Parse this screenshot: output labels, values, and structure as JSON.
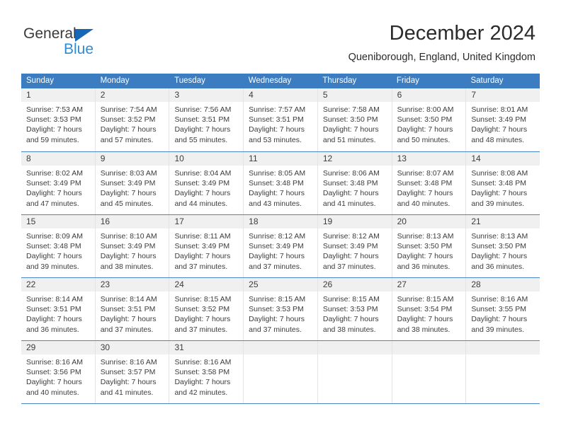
{
  "brand": {
    "name_dark": "General",
    "name_blue": "Blue",
    "color_dark": "#3a3a3a",
    "color_blue": "#2e8bd4",
    "triangle_color": "#1667b4"
  },
  "header": {
    "title": "December 2024",
    "subtitle": "Queniborough, England, United Kingdom"
  },
  "theme": {
    "header_row_bg": "#3b7dc0",
    "header_row_text": "#ffffff",
    "day_number_band_bg": "#f0f0f0",
    "week_divider": "#4a86c5",
    "column_divider": "#e4e4e4",
    "body_text": "#3c3c3c"
  },
  "calendar": {
    "day_names": [
      "Sunday",
      "Monday",
      "Tuesday",
      "Wednesday",
      "Thursday",
      "Friday",
      "Saturday"
    ],
    "weeks": [
      [
        {
          "day": "1",
          "sunrise": "Sunrise: 7:53 AM",
          "sunset": "Sunset: 3:53 PM",
          "daylight_line1": "Daylight: 7 hours",
          "daylight_line2": "and 59 minutes."
        },
        {
          "day": "2",
          "sunrise": "Sunrise: 7:54 AM",
          "sunset": "Sunset: 3:52 PM",
          "daylight_line1": "Daylight: 7 hours",
          "daylight_line2": "and 57 minutes."
        },
        {
          "day": "3",
          "sunrise": "Sunrise: 7:56 AM",
          "sunset": "Sunset: 3:51 PM",
          "daylight_line1": "Daylight: 7 hours",
          "daylight_line2": "and 55 minutes."
        },
        {
          "day": "4",
          "sunrise": "Sunrise: 7:57 AM",
          "sunset": "Sunset: 3:51 PM",
          "daylight_line1": "Daylight: 7 hours",
          "daylight_line2": "and 53 minutes."
        },
        {
          "day": "5",
          "sunrise": "Sunrise: 7:58 AM",
          "sunset": "Sunset: 3:50 PM",
          "daylight_line1": "Daylight: 7 hours",
          "daylight_line2": "and 51 minutes."
        },
        {
          "day": "6",
          "sunrise": "Sunrise: 8:00 AM",
          "sunset": "Sunset: 3:50 PM",
          "daylight_line1": "Daylight: 7 hours",
          "daylight_line2": "and 50 minutes."
        },
        {
          "day": "7",
          "sunrise": "Sunrise: 8:01 AM",
          "sunset": "Sunset: 3:49 PM",
          "daylight_line1": "Daylight: 7 hours",
          "daylight_line2": "and 48 minutes."
        }
      ],
      [
        {
          "day": "8",
          "sunrise": "Sunrise: 8:02 AM",
          "sunset": "Sunset: 3:49 PM",
          "daylight_line1": "Daylight: 7 hours",
          "daylight_line2": "and 47 minutes."
        },
        {
          "day": "9",
          "sunrise": "Sunrise: 8:03 AM",
          "sunset": "Sunset: 3:49 PM",
          "daylight_line1": "Daylight: 7 hours",
          "daylight_line2": "and 45 minutes."
        },
        {
          "day": "10",
          "sunrise": "Sunrise: 8:04 AM",
          "sunset": "Sunset: 3:49 PM",
          "daylight_line1": "Daylight: 7 hours",
          "daylight_line2": "and 44 minutes."
        },
        {
          "day": "11",
          "sunrise": "Sunrise: 8:05 AM",
          "sunset": "Sunset: 3:48 PM",
          "daylight_line1": "Daylight: 7 hours",
          "daylight_line2": "and 43 minutes."
        },
        {
          "day": "12",
          "sunrise": "Sunrise: 8:06 AM",
          "sunset": "Sunset: 3:48 PM",
          "daylight_line1": "Daylight: 7 hours",
          "daylight_line2": "and 41 minutes."
        },
        {
          "day": "13",
          "sunrise": "Sunrise: 8:07 AM",
          "sunset": "Sunset: 3:48 PM",
          "daylight_line1": "Daylight: 7 hours",
          "daylight_line2": "and 40 minutes."
        },
        {
          "day": "14",
          "sunrise": "Sunrise: 8:08 AM",
          "sunset": "Sunset: 3:48 PM",
          "daylight_line1": "Daylight: 7 hours",
          "daylight_line2": "and 39 minutes."
        }
      ],
      [
        {
          "day": "15",
          "sunrise": "Sunrise: 8:09 AM",
          "sunset": "Sunset: 3:48 PM",
          "daylight_line1": "Daylight: 7 hours",
          "daylight_line2": "and 39 minutes."
        },
        {
          "day": "16",
          "sunrise": "Sunrise: 8:10 AM",
          "sunset": "Sunset: 3:49 PM",
          "daylight_line1": "Daylight: 7 hours",
          "daylight_line2": "and 38 minutes."
        },
        {
          "day": "17",
          "sunrise": "Sunrise: 8:11 AM",
          "sunset": "Sunset: 3:49 PM",
          "daylight_line1": "Daylight: 7 hours",
          "daylight_line2": "and 37 minutes."
        },
        {
          "day": "18",
          "sunrise": "Sunrise: 8:12 AM",
          "sunset": "Sunset: 3:49 PM",
          "daylight_line1": "Daylight: 7 hours",
          "daylight_line2": "and 37 minutes."
        },
        {
          "day": "19",
          "sunrise": "Sunrise: 8:12 AM",
          "sunset": "Sunset: 3:49 PM",
          "daylight_line1": "Daylight: 7 hours",
          "daylight_line2": "and 37 minutes."
        },
        {
          "day": "20",
          "sunrise": "Sunrise: 8:13 AM",
          "sunset": "Sunset: 3:50 PM",
          "daylight_line1": "Daylight: 7 hours",
          "daylight_line2": "and 36 minutes."
        },
        {
          "day": "21",
          "sunrise": "Sunrise: 8:13 AM",
          "sunset": "Sunset: 3:50 PM",
          "daylight_line1": "Daylight: 7 hours",
          "daylight_line2": "and 36 minutes."
        }
      ],
      [
        {
          "day": "22",
          "sunrise": "Sunrise: 8:14 AM",
          "sunset": "Sunset: 3:51 PM",
          "daylight_line1": "Daylight: 7 hours",
          "daylight_line2": "and 36 minutes."
        },
        {
          "day": "23",
          "sunrise": "Sunrise: 8:14 AM",
          "sunset": "Sunset: 3:51 PM",
          "daylight_line1": "Daylight: 7 hours",
          "daylight_line2": "and 37 minutes."
        },
        {
          "day": "24",
          "sunrise": "Sunrise: 8:15 AM",
          "sunset": "Sunset: 3:52 PM",
          "daylight_line1": "Daylight: 7 hours",
          "daylight_line2": "and 37 minutes."
        },
        {
          "day": "25",
          "sunrise": "Sunrise: 8:15 AM",
          "sunset": "Sunset: 3:53 PM",
          "daylight_line1": "Daylight: 7 hours",
          "daylight_line2": "and 37 minutes."
        },
        {
          "day": "26",
          "sunrise": "Sunrise: 8:15 AM",
          "sunset": "Sunset: 3:53 PM",
          "daylight_line1": "Daylight: 7 hours",
          "daylight_line2": "and 38 minutes."
        },
        {
          "day": "27",
          "sunrise": "Sunrise: 8:15 AM",
          "sunset": "Sunset: 3:54 PM",
          "daylight_line1": "Daylight: 7 hours",
          "daylight_line2": "and 38 minutes."
        },
        {
          "day": "28",
          "sunrise": "Sunrise: 8:16 AM",
          "sunset": "Sunset: 3:55 PM",
          "daylight_line1": "Daylight: 7 hours",
          "daylight_line2": "and 39 minutes."
        }
      ],
      [
        {
          "day": "29",
          "sunrise": "Sunrise: 8:16 AM",
          "sunset": "Sunset: 3:56 PM",
          "daylight_line1": "Daylight: 7 hours",
          "daylight_line2": "and 40 minutes."
        },
        {
          "day": "30",
          "sunrise": "Sunrise: 8:16 AM",
          "sunset": "Sunset: 3:57 PM",
          "daylight_line1": "Daylight: 7 hours",
          "daylight_line2": "and 41 minutes."
        },
        {
          "day": "31",
          "sunrise": "Sunrise: 8:16 AM",
          "sunset": "Sunset: 3:58 PM",
          "daylight_line1": "Daylight: 7 hours",
          "daylight_line2": "and 42 minutes."
        },
        {
          "day": "",
          "sunrise": "",
          "sunset": "",
          "daylight_line1": "",
          "daylight_line2": ""
        },
        {
          "day": "",
          "sunrise": "",
          "sunset": "",
          "daylight_line1": "",
          "daylight_line2": ""
        },
        {
          "day": "",
          "sunrise": "",
          "sunset": "",
          "daylight_line1": "",
          "daylight_line2": ""
        },
        {
          "day": "",
          "sunrise": "",
          "sunset": "",
          "daylight_line1": "",
          "daylight_line2": ""
        }
      ]
    ]
  }
}
